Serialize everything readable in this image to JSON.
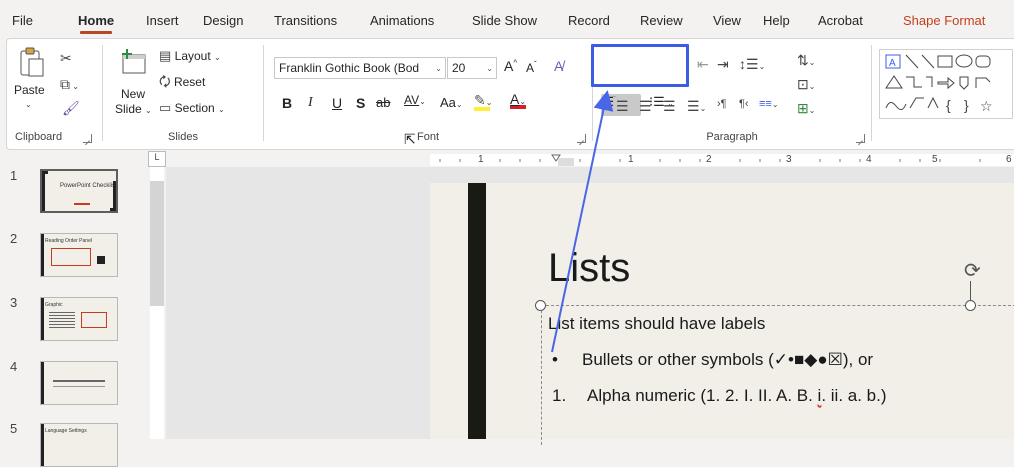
{
  "menu": {
    "tabs": [
      "File",
      "Home",
      "Insert",
      "Design",
      "Transitions",
      "Animations",
      "Slide Show",
      "Record",
      "Review",
      "View",
      "Help",
      "Acrobat",
      "Shape Format"
    ]
  },
  "ribbon": {
    "clipboard": {
      "paste_label": "Paste",
      "group_label": "Clipboard"
    },
    "slides": {
      "new_slide_label": "New",
      "new_slide_label2": "Slide",
      "layout_label": "Layout",
      "reset_label": "Reset",
      "section_label": "Section",
      "group_label": "Slides"
    },
    "font": {
      "font_name": "Franklin Gothic Book (Bod",
      "font_size": "20",
      "group_label": "Font",
      "bold": "B",
      "italic": "I",
      "underline": "U",
      "shadow": "S",
      "strike": "ab",
      "spacing": "AV",
      "case": "Aa"
    },
    "paragraph": {
      "group_label": "Paragraph"
    }
  },
  "thumbnails": [
    {
      "num": "1",
      "title": "PowerPoint Checklist"
    },
    {
      "num": "2",
      "title": "Reading Order Panel"
    },
    {
      "num": "3",
      "title": "Graphic"
    },
    {
      "num": "4",
      "title": ""
    },
    {
      "num": "5",
      "title": "Language Settings"
    }
  ],
  "ruler": {
    "corner": "L",
    "h_marks": [
      "1",
      "1",
      "2",
      "3",
      "4",
      "5",
      "6"
    ]
  },
  "slide": {
    "title": "Lists",
    "line1": "List items should have labels",
    "bullet": "•",
    "line2": "Bullets or other symbols (✓•■◆●☒), or",
    "num": "1.",
    "line3_a": "Alpha numeric (1. 2. I. II. A. B. ",
    "line3_i": "i",
    "line3_b": ". ii. a. b.)"
  },
  "colors": {
    "accent": "#b7472a",
    "highlight": "#3d5ce6",
    "contextual_tab": "#c43e1c"
  }
}
